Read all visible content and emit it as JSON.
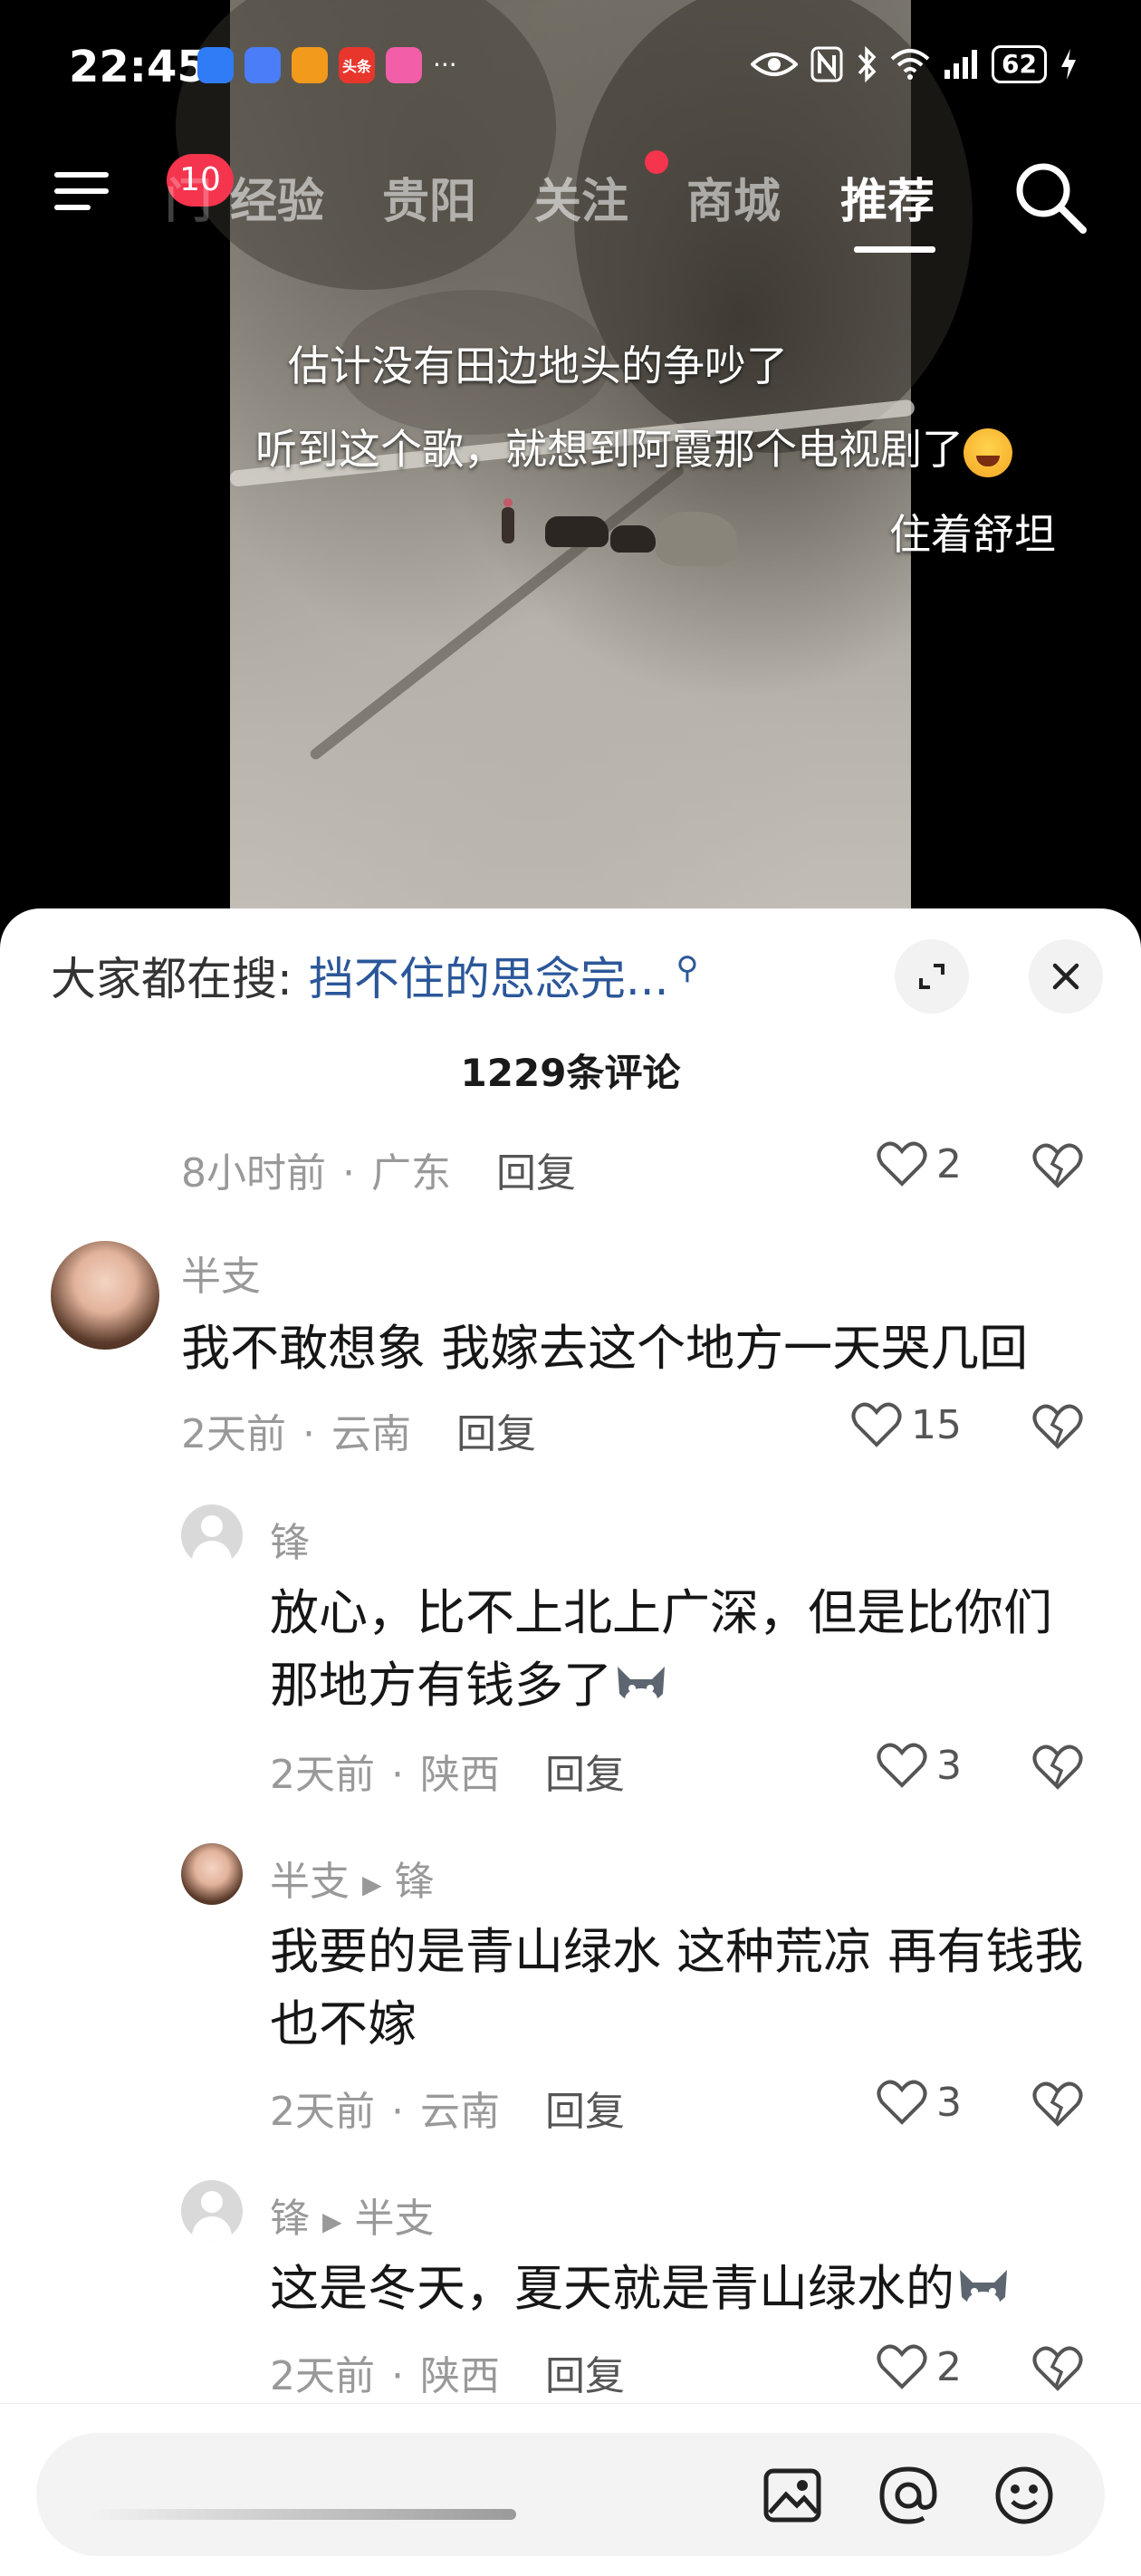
{
  "status_bar": {
    "time": "22:45",
    "battery": "62",
    "apps": [
      {
        "icon": "app-ring-icon",
        "color": "#2f7cf6",
        "label": ""
      },
      {
        "icon": "app-globe-icon",
        "color": "#4a7df7",
        "label": ""
      },
      {
        "icon": "app-play-icon",
        "color": "#f29a1b",
        "label": ""
      },
      {
        "icon": "app-toutiao-icon",
        "color": "#e8362d",
        "label": "头条"
      },
      {
        "icon": "app-bubble-icon",
        "color": "#f25ea8",
        "label": ""
      }
    ],
    "more": "···"
  },
  "nav": {
    "badge_count": "10",
    "partial_tab": "门",
    "tabs": [
      "经验",
      "贵阳",
      "关注",
      "商城",
      "推荐"
    ],
    "active_tab": "推荐"
  },
  "danmu": [
    "估计没有田边地头的争吵了",
    "听到这个歌，就想到阿霞那个电视剧了",
    "住着舒坦"
  ],
  "sheet": {
    "search_label": "大家都在搜:",
    "search_query": "挡不住的思念完...",
    "comment_count": "1229条评论",
    "reply_label": "回复"
  },
  "comments": [
    {
      "time": "8小时前",
      "region": "广东",
      "likes": "2"
    },
    {
      "user": "半支",
      "text": "我不敢想象 我嫁去这个地方一天哭几回",
      "time": "2天前",
      "region": "云南",
      "likes": "15"
    },
    {
      "user": "锋",
      "text": "放心，比不上北上广深，但是比你们那地方有钱多了",
      "time": "2天前",
      "region": "陕西",
      "likes": "3"
    },
    {
      "user": "半支",
      "reply_to": "锋",
      "text": "我要的是青山绿水 这种荒凉 再有钱我也不嫁",
      "time": "2天前",
      "region": "云南",
      "likes": "3"
    },
    {
      "user": "锋",
      "reply_to": "半支",
      "text": "这是冬天，夏天就是青山绿水的",
      "time": "2天前",
      "region": "陕西",
      "likes": "2"
    }
  ],
  "input": {
    "placeholder": ""
  }
}
